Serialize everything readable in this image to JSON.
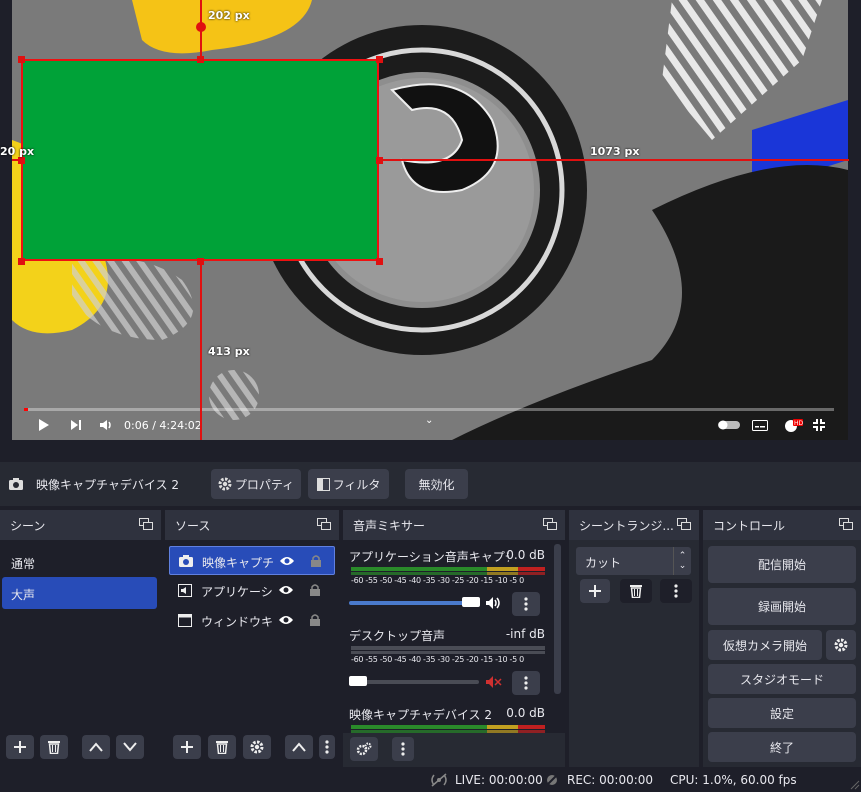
{
  "preview": {
    "dim_top": "202 px",
    "dim_left": "20 px",
    "dim_right": "1073 px",
    "dim_bottom": "413 px",
    "video_time": "0:06 / 4:24:02",
    "progress_fraction": 0.0004
  },
  "source_bar": {
    "source_name": "映像キャプチャデバイス 2",
    "properties_label": "プロパティ",
    "filters_label": "フィルタ",
    "disable_label": "無効化"
  },
  "scenes": {
    "title": "シーン",
    "items": [
      "通常",
      "大声"
    ],
    "selected_index": 1
  },
  "sources": {
    "title": "ソース",
    "items": [
      "映像キャプチャ",
      "アプリケーション",
      "ウィンドウキャプ"
    ]
  },
  "mixer": {
    "title": "音声ミキサー",
    "ticks": "-60 -55 -50 -45 -40 -35 -30 -25 -20 -15 -10 -5  0",
    "channels": [
      {
        "name": "アプリケーション音声キャプチャ (",
        "db": "0.0 dB",
        "muted": false,
        "volume": 1.0
      },
      {
        "name": "デスクトップ音声",
        "db": "-inf dB",
        "muted": true,
        "volume": 0.0
      },
      {
        "name": "映像キャプチャデバイス 2",
        "db": "0.0 dB",
        "muted": false,
        "volume": 1.0
      }
    ]
  },
  "transitions": {
    "title": "シーントランジ...",
    "current": "カット"
  },
  "controls": {
    "title": "コントロール",
    "start_streaming": "配信開始",
    "start_recording": "録画開始",
    "start_virtual_camera": "仮想カメラ開始",
    "studio_mode": "スタジオモード",
    "settings": "設定",
    "exit": "終了"
  },
  "status": {
    "live": "LIVE: 00:00:00",
    "rec": "REC: 00:00:00",
    "cpu": "CPU: 1.0%, 60.00 fps"
  },
  "colors": {
    "accent": "#284cb8",
    "green_source": "#00a238",
    "selection": "#e01010"
  }
}
